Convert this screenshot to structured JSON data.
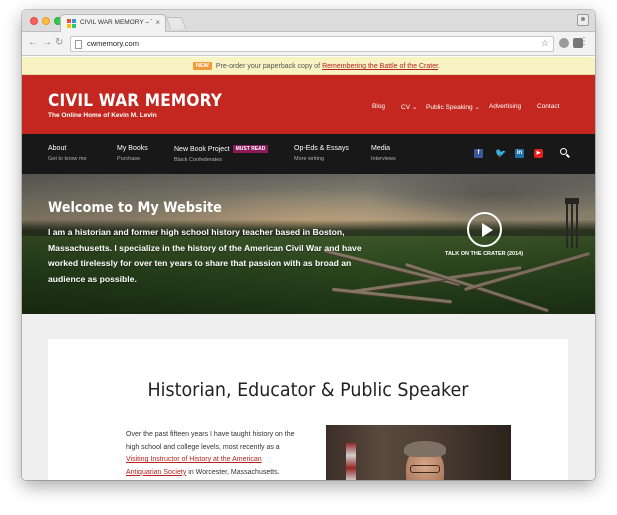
{
  "browser": {
    "tab_title": "CIVIL WAR MEMORY – The Online",
    "tab_close": "×",
    "url": "cwmemory.com",
    "icons": {
      "back": "back-arrow-icon",
      "forward": "forward-arrow-icon",
      "reload": "reload-icon",
      "star": "star-icon",
      "menu": "menu-dots-icon"
    },
    "glyphs": {
      "back": "←",
      "forward": "→",
      "reload": "↻",
      "star": "☆",
      "menu": "⋮"
    }
  },
  "promo": {
    "badge": "NEW",
    "text": "Pre-order your paperback copy of ",
    "link": "Remembering the Battle of the Crater",
    "suffix": "."
  },
  "header": {
    "title": "CIVIL WAR MEMORY",
    "tagline": "The Online Home of Kevin M. Levin",
    "nav": [
      "Blog",
      "CV",
      "Public Speaking",
      "Advertising",
      "Contact"
    ]
  },
  "menu": [
    {
      "label": "About",
      "sub": "Get to know me"
    },
    {
      "label": "My Books",
      "sub": "Purchase"
    },
    {
      "label": "New Book Project",
      "badge": "MUST READ",
      "sub": "Black Confederates"
    },
    {
      "label": "Op-Eds & Essays",
      "sub": "More writing"
    },
    {
      "label": "Media",
      "sub": "Interviews"
    }
  ],
  "social": {
    "facebook": "f",
    "twitter": "🐦",
    "linkedin": "in",
    "youtube": "▶"
  },
  "hero": {
    "title": "Welcome to My Website",
    "text": "I am a historian and former high school history teacher based in Boston, Massachusetts. I specialize in the history of the American Civil War and have worked tirelessly for over ten years to share that passion with as broad an audience as possible.",
    "video_caption": "TALK ON THE CRATER (2014)"
  },
  "content": {
    "title": "Historian, Educator & Public Speaker",
    "text_before": "Over the past fifteen years I have taught history on the high school and college levels, most recently as a ",
    "link": "Visiting Instructor of History at the American Antiquarian Society",
    "text_after": " in Worcester, Massachusetts."
  },
  "colors": {
    "brand_red": "#c3271f",
    "menu_bg": "#181818",
    "promo_bg": "#f9f3c4",
    "badge_orange": "#f29a3b",
    "must_read": "#8c1a5c"
  }
}
